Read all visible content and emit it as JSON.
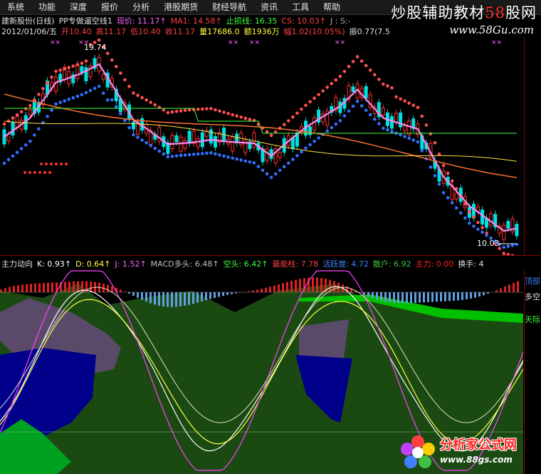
{
  "menu": [
    "系统",
    "功能",
    "深度",
    "报价",
    "分析",
    "港股期货",
    "财经导航",
    "资讯",
    "工具",
    "帮助"
  ],
  "brand": {
    "text_prefix": "炒股辅助教材",
    "text_hl": "58",
    "text_suffix": "股网",
    "url": "www.58Gu.com"
  },
  "info1": [
    {
      "text": "建新股份(日线)",
      "color": "#e0e0e0"
    },
    {
      "text": "PP专做逼空线1",
      "color": "#e0e0e0"
    },
    {
      "text": "现价: 11.17↑",
      "color": "#ff66ff"
    },
    {
      "text": "MA1: 14.58↑",
      "color": "#ff4040"
    },
    {
      "text": "止损线: 16.35",
      "color": "#40ff40"
    },
    {
      "text": "CS: 10.03↑",
      "color": "#ff4040"
    },
    {
      "text": "J : S:-",
      "color": "#aaaaaa"
    }
  ],
  "info2": [
    {
      "text": "2012/01/06/五",
      "color": "#e0e0e0"
    },
    {
      "text": "开10.40",
      "color": "#ff4040"
    },
    {
      "text": "高11.17",
      "color": "#ff4040"
    },
    {
      "text": "低10.40",
      "color": "#ff4040"
    },
    {
      "text": "收11.17",
      "color": "#ff4040"
    },
    {
      "text": "量17686.0",
      "color": "#ffff40"
    },
    {
      "text": "额1936万",
      "color": "#ffff40"
    },
    {
      "text": "幅1.02(10.05%)",
      "color": "#ff4040"
    },
    {
      "text": "振0.77(7.5",
      "color": "#e0e0e0"
    }
  ],
  "indicator": [
    {
      "text": "主力动向",
      "color": "#e0e0e0"
    },
    {
      "text": "K: 0.93↑",
      "color": "#ffffff"
    },
    {
      "text": "D: 0.64↑",
      "color": "#ffff40"
    },
    {
      "text": "J: 1.52↑",
      "color": "#ff66ff"
    },
    {
      "text": "MACD多头: 6.48↑",
      "color": "#c0c0c0"
    },
    {
      "text": "空头: 6.42↑",
      "color": "#40ff40"
    },
    {
      "text": "最能柱: 7.78",
      "color": "#ff4040"
    },
    {
      "text": "活跃度: 4.72",
      "color": "#4080ff"
    },
    {
      "text": "散户: 6.92",
      "color": "#40c040"
    },
    {
      "text": "主力: 0.00",
      "color": "#ff2020"
    },
    {
      "text": "换手: 4",
      "color": "#e0e0e0"
    }
  ],
  "annotations": {
    "high": "19.74",
    "low": "10.03"
  },
  "sub_axis_labels": [
    {
      "text": "顶部",
      "color": "#4080ff"
    },
    {
      "text": "多空",
      "color": "#e0e0e0"
    },
    {
      "text": "天际",
      "color": "#40ff40"
    }
  ],
  "watermark": {
    "title": "分析家公式网",
    "url": "www.88gs.com"
  }
}
